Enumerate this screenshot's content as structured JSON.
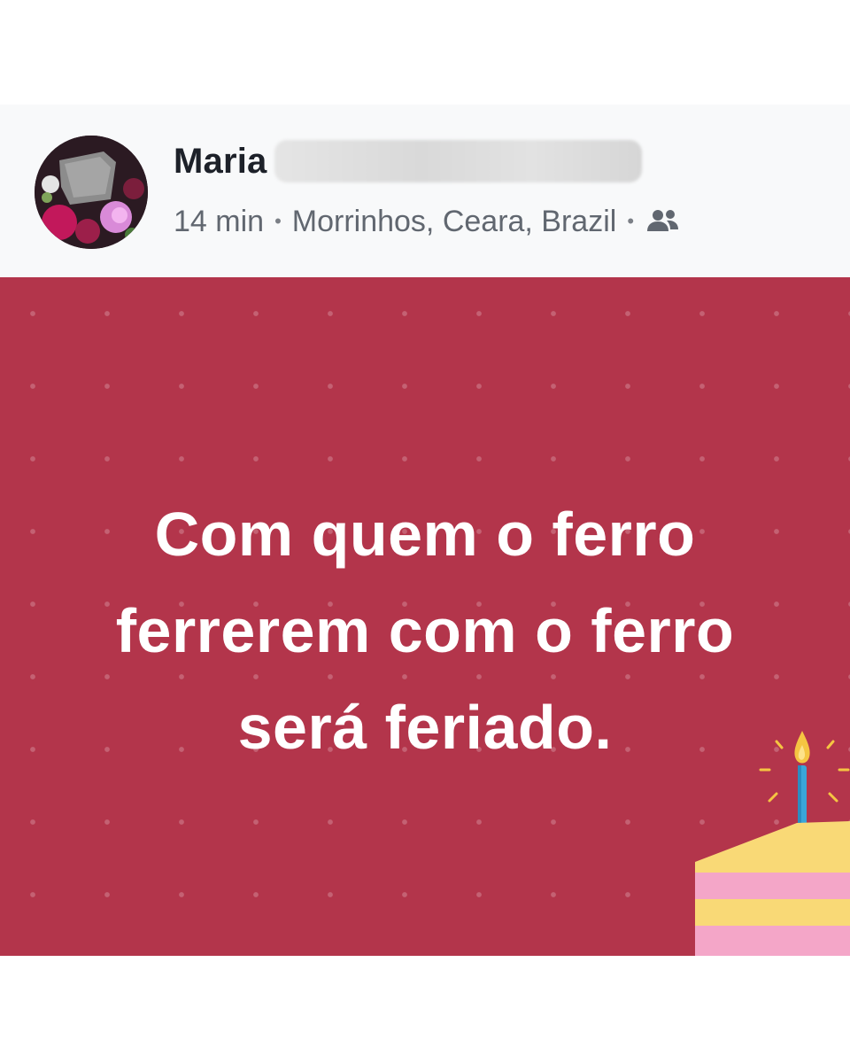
{
  "post": {
    "author": {
      "first_name": "Maria"
    },
    "meta": {
      "time": "14 min",
      "separator": "•",
      "location": "Morrinhos, Ceara, Brazil",
      "audience_icon": "friends-icon"
    },
    "content": {
      "line1": "Com quem o ferro",
      "line2": "ferrerem com o ferro",
      "line3": "será feriado.",
      "background_color": "#b3354b",
      "text_color": "#ffffff"
    }
  },
  "colors": {
    "header_bg": "#f8f9fa",
    "name_text": "#1d2129",
    "meta_text": "#616770"
  }
}
